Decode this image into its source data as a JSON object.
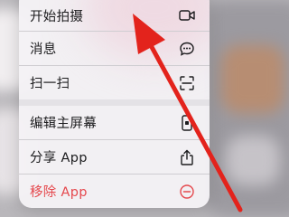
{
  "menu": {
    "items": [
      {
        "label": "开始拍摄",
        "icon": "video-camera-icon"
      },
      {
        "label": "消息",
        "icon": "message-bubble-icon"
      },
      {
        "label": "扫一扫",
        "icon": "scan-icon"
      },
      {
        "label": "编辑主屏幕",
        "icon": "phone-edit-icon"
      },
      {
        "label": "分享 App",
        "icon": "share-icon"
      },
      {
        "label": "移除 App",
        "icon": "minus-circle-icon"
      }
    ]
  },
  "colors": {
    "danger": "#e5484d",
    "arrow": "#e3231c"
  }
}
